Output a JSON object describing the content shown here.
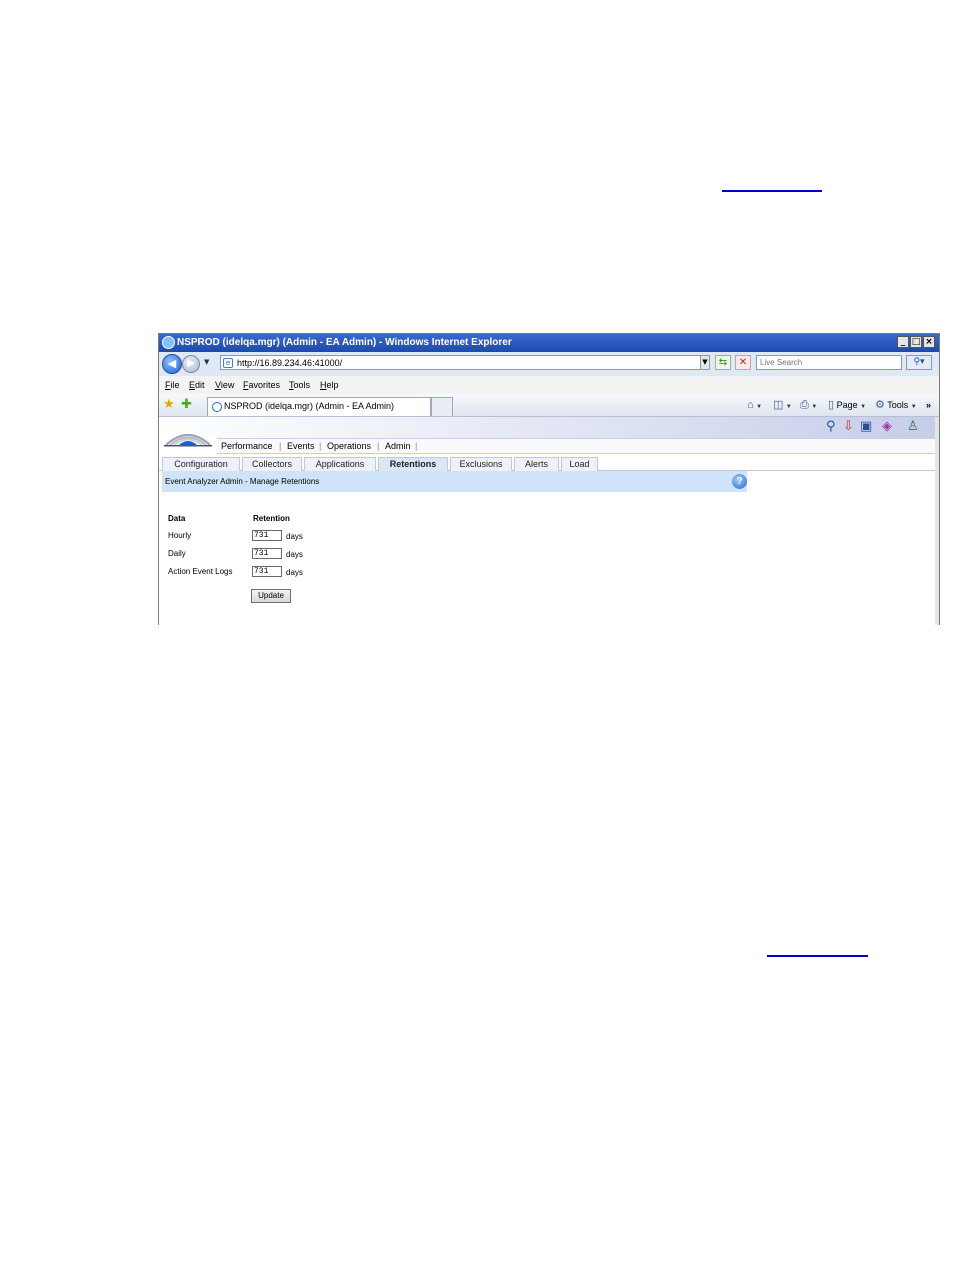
{
  "window": {
    "title": "NSPROD (idelqa.mgr) (Admin - EA Admin) - Windows Internet Explorer",
    "min_glyph": "_",
    "max_glyph": "□",
    "close_glyph": "×"
  },
  "address_bar": {
    "url": "http://16.89.234.46:41000/",
    "search_placeholder": "Live Search"
  },
  "menu": {
    "items": [
      "File",
      "Edit",
      "View",
      "Favorites",
      "Tools",
      "Help"
    ]
  },
  "favorites_bar": {
    "tab_title": "NSPROD (idelqa.mgr) (Admin - EA Admin)",
    "page_label": "Page",
    "tools_label": "Tools",
    "overflow": "»"
  },
  "app": {
    "main_nav": [
      "Performance",
      "Events",
      "Operations",
      "Admin"
    ],
    "sub_tabs": [
      "Configuration",
      "Collectors",
      "Applications",
      "Retentions",
      "Exclusions",
      "Alerts",
      "Load"
    ],
    "active_sub_tab": "Retentions",
    "page_heading": "Event Analyzer Admin - Manage Retentions",
    "help_glyph": "?",
    "form": {
      "col_data": "Data",
      "col_retention": "Retention",
      "rows": [
        {
          "label": "Hourly",
          "value": "731",
          "unit": "days"
        },
        {
          "label": "Daily",
          "value": "731",
          "unit": "days"
        },
        {
          "label": "Action Event Logs",
          "value": "731",
          "unit": "days"
        }
      ],
      "update_label": "Update"
    }
  }
}
